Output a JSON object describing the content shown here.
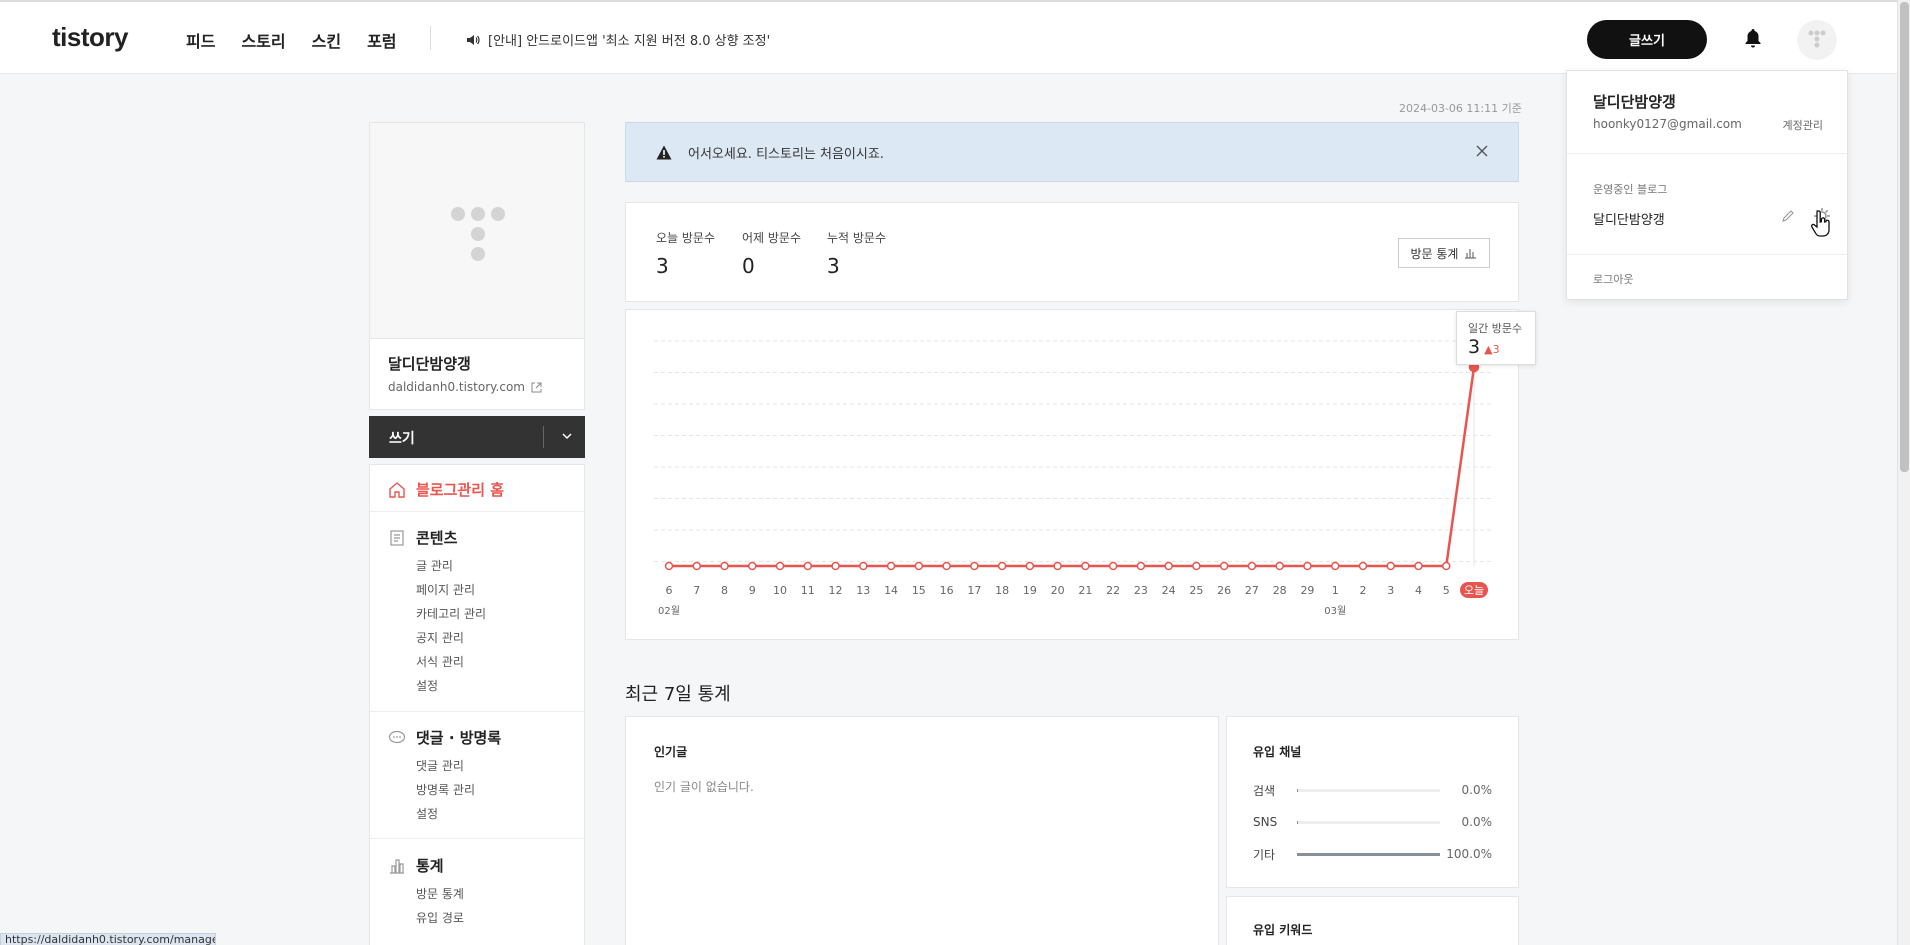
{
  "header": {
    "logo": "tistory",
    "nav": [
      "피드",
      "스토리",
      "스킨",
      "포럼"
    ],
    "notice": "[안내] 안드로이드앱 '최소 지원 버전 8.0 상향 조정'",
    "write_button": "글쓰기"
  },
  "sidebar": {
    "blog_name": "달디단밤양갱",
    "blog_url": "daldidanh0.tistory.com",
    "write_label": "쓰기",
    "home_label": "블로그관리 홈",
    "sections": [
      {
        "title": "콘텐츠",
        "items": [
          "글 관리",
          "페이지 관리",
          "카테고리 관리",
          "공지 관리",
          "서식 관리",
          "설정"
        ]
      },
      {
        "title": "댓글 · 방명록",
        "items": [
          "댓글 관리",
          "방명록 관리",
          "설정"
        ]
      },
      {
        "title": "통계",
        "items": [
          "방문 통계",
          "유입 경로"
        ]
      }
    ]
  },
  "main": {
    "timestamp": "2024-03-06 11:11 기준",
    "welcome": "어서오세요. 티스토리는 처음이시죠.",
    "visitors": [
      {
        "label": "오늘 방문수",
        "value": "3"
      },
      {
        "label": "어제 방문수",
        "value": "0"
      },
      {
        "label": "누적 방문수",
        "value": "3"
      }
    ],
    "stats_button": "방문 통계",
    "tooltip": {
      "label": "일간 방문수",
      "value": "3",
      "delta": "3"
    },
    "recent_title": "최근 7일 통계",
    "popular_title": "인기글",
    "popular_empty": "인기 글이 없습니다.",
    "channels_title": "유입 채널",
    "channels": [
      {
        "name": "검색",
        "value": 0.0,
        "label": "0.0%"
      },
      {
        "name": "SNS",
        "value": 0.0,
        "label": "0.0%"
      },
      {
        "name": "기타",
        "value": 100.0,
        "label": "100.0%"
      }
    ],
    "keywords_title": "유입 키워드"
  },
  "chart_data": {
    "type": "line",
    "x": [
      "6",
      "7",
      "8",
      "9",
      "10",
      "11",
      "12",
      "13",
      "14",
      "15",
      "16",
      "17",
      "18",
      "19",
      "20",
      "21",
      "22",
      "23",
      "24",
      "25",
      "26",
      "27",
      "28",
      "29",
      "1",
      "2",
      "3",
      "4",
      "5",
      "오늘"
    ],
    "series": [
      {
        "values": [
          0,
          0,
          0,
          0,
          0,
          0,
          0,
          0,
          0,
          0,
          0,
          0,
          0,
          0,
          0,
          0,
          0,
          0,
          0,
          0,
          0,
          0,
          0,
          0,
          0,
          0,
          0,
          0,
          0,
          3
        ]
      }
    ],
    "month_labels": [
      {
        "at": "6",
        "label": "02월"
      },
      {
        "at": "1",
        "label": "03월"
      }
    ],
    "color": "#e8554e",
    "ylim": [
      0,
      3.4
    ]
  },
  "dropdown": {
    "name": "달디단밤양갱",
    "email": "hoonky0127@gmail.com",
    "account": "계정관리",
    "blogs_label": "운영중인 블로그",
    "blog": "달디단밤양갱",
    "logout": "로그아웃"
  },
  "status_bar_url": "https://daldidanh0.tistory.com/manage"
}
